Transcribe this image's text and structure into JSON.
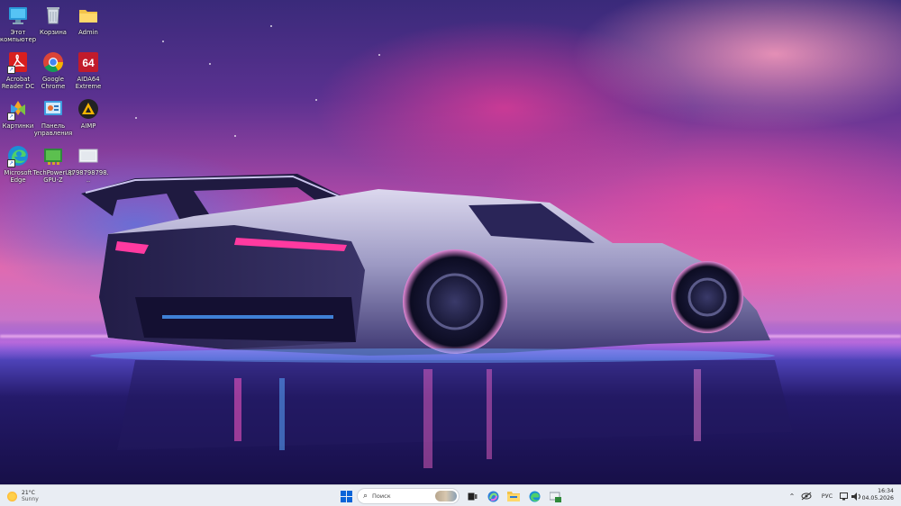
{
  "desktop": {
    "icons": [
      {
        "name": "this-pc",
        "label": "Этот компьютер"
      },
      {
        "name": "recycle-bin",
        "label": "Корзина"
      },
      {
        "name": "admin-folder",
        "label": "Admin"
      },
      {
        "name": "acrobat-reader",
        "label": "Acrobat Reader DC"
      },
      {
        "name": "google-chrome",
        "label": "Google Chrome"
      },
      {
        "name": "aida64",
        "label": "AIDA64 Extreme"
      },
      {
        "name": "kartinki",
        "label": "Картинки"
      },
      {
        "name": "control-panel",
        "label": "Панель управления"
      },
      {
        "name": "aimp",
        "label": "AIMP"
      },
      {
        "name": "microsoft-edge",
        "label": "Microsoft Edge"
      },
      {
        "name": "gpu-z",
        "label": "TechPowerUp GPU-Z"
      },
      {
        "name": "file-8798",
        "label": "8798798798..."
      }
    ]
  },
  "taskbar": {
    "weather": {
      "temp": "21°C",
      "condition": "Sunny"
    },
    "search": {
      "placeholder": "Поиск"
    },
    "tray": {
      "language": "РУС"
    },
    "clock": {
      "time": "16:34",
      "date": "04.05.2026"
    }
  },
  "colors": {
    "taskbar_bg": "#e9edf3",
    "accent_blue": "#0a64d8"
  }
}
